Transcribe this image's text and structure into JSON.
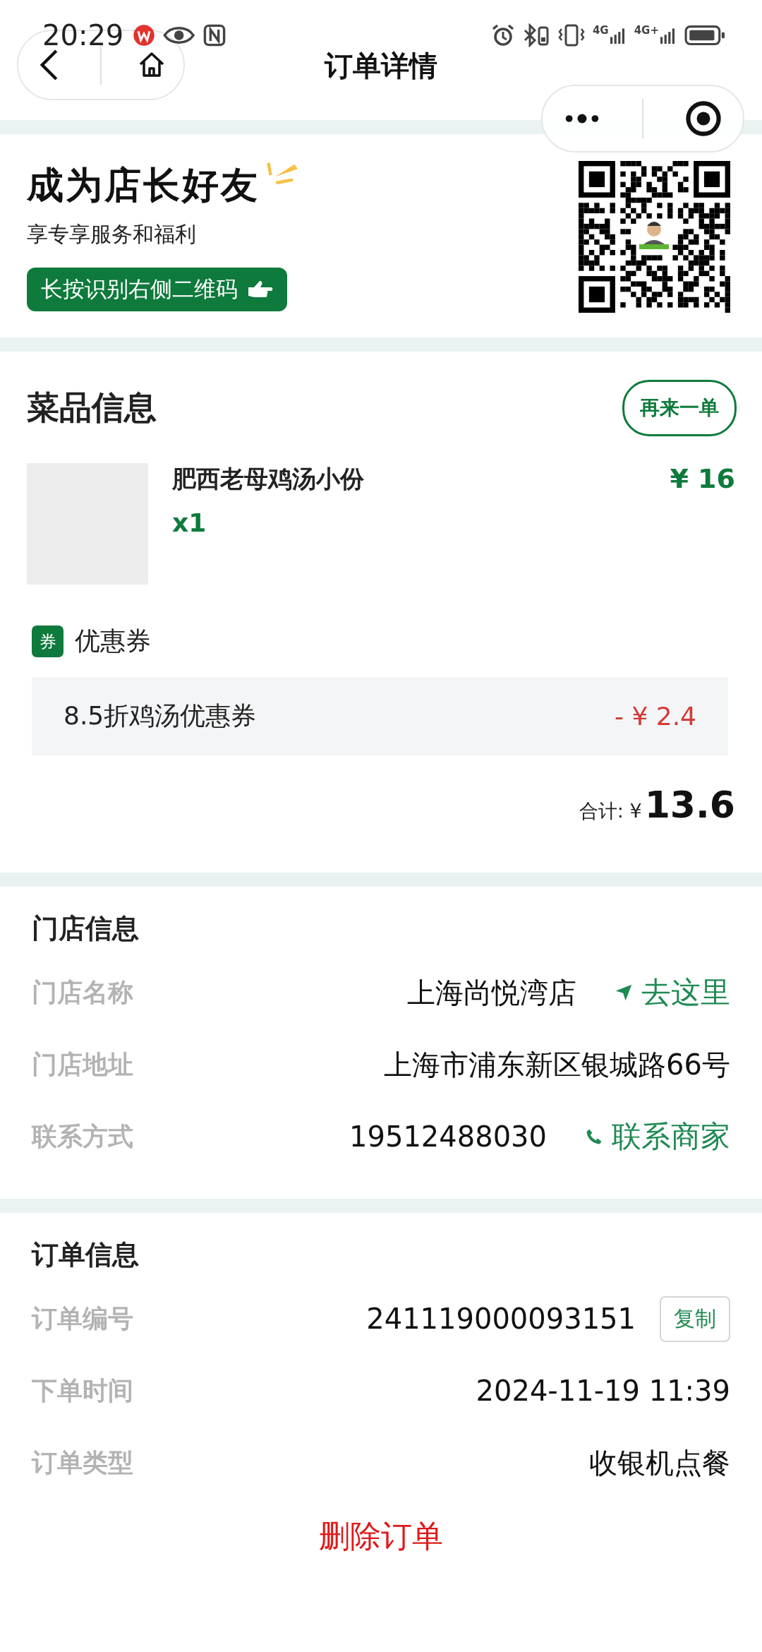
{
  "status_bar": {
    "time": "20:29",
    "networks": [
      {
        "label": "4G"
      },
      {
        "label": "4G+"
      }
    ]
  },
  "nav": {
    "title": "订单详情"
  },
  "promo": {
    "title": "成为店长好友",
    "subtitle": "享专享服务和福利",
    "button": "长按识别右侧二维码"
  },
  "dishes": {
    "title": "菜品信息",
    "reorder_button": "再来一单",
    "items": [
      {
        "name": "肥西老母鸡汤小份",
        "quantity": "x1",
        "price": "¥ 16"
      }
    ],
    "coupon_badge": "券",
    "coupon_label": "优惠券",
    "coupons": [
      {
        "name": "8.5折鸡汤优惠券",
        "amount": "- ¥ 2.4"
      }
    ],
    "total_label": "合计: ¥",
    "total": "13.6"
  },
  "store": {
    "title": "门店信息",
    "rows": [
      {
        "kind": "navigate",
        "label": "门店名称",
        "value": "上海尚悦湾店",
        "action": "去这里"
      },
      {
        "kind": "plain",
        "label": "门店地址",
        "value": "上海市浦东新区银城路66号"
      },
      {
        "kind": "call",
        "label": "联系方式",
        "value": "19512488030",
        "action": "联系商家"
      }
    ]
  },
  "order": {
    "title": "订单信息",
    "rows": [
      {
        "kind": "copy",
        "label": "订单编号",
        "value": "241119000093151",
        "action": "复制"
      },
      {
        "kind": "plain",
        "label": "下单时间",
        "value": "2024-11-19 11:39"
      },
      {
        "kind": "plain",
        "label": "订单类型",
        "value": "收银机点餐"
      }
    ],
    "delete_button": "删除订单"
  }
}
